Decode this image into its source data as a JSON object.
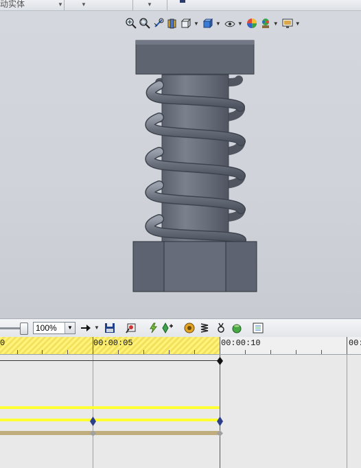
{
  "menu": {
    "partial_label": "动实体"
  },
  "view_toolbar": {
    "icons": [
      "zoom-to-fit-icon",
      "zoom-area-icon",
      "previous-view-icon",
      "section-view-icon",
      "view-orientation-icon",
      "display-style-icon",
      "hide-show-items-icon",
      "edit-appearance-icon",
      "apply-scene-icon",
      "view-settings-icon"
    ]
  },
  "animation_toolbar": {
    "zoom_value": "100%",
    "zoom_options": [
      "100%"
    ]
  },
  "timeline": {
    "marks": [
      "0",
      "00:00:05",
      "00:00:10",
      "00:"
    ]
  },
  "colors": {
    "part_fill": "#5c6270",
    "part_dark": "#454a55",
    "part_light": "#8a909c",
    "track_yellow": "#ffff33",
    "track_tan": "#c0ad7e",
    "key_blue": "#2b3e8a"
  }
}
